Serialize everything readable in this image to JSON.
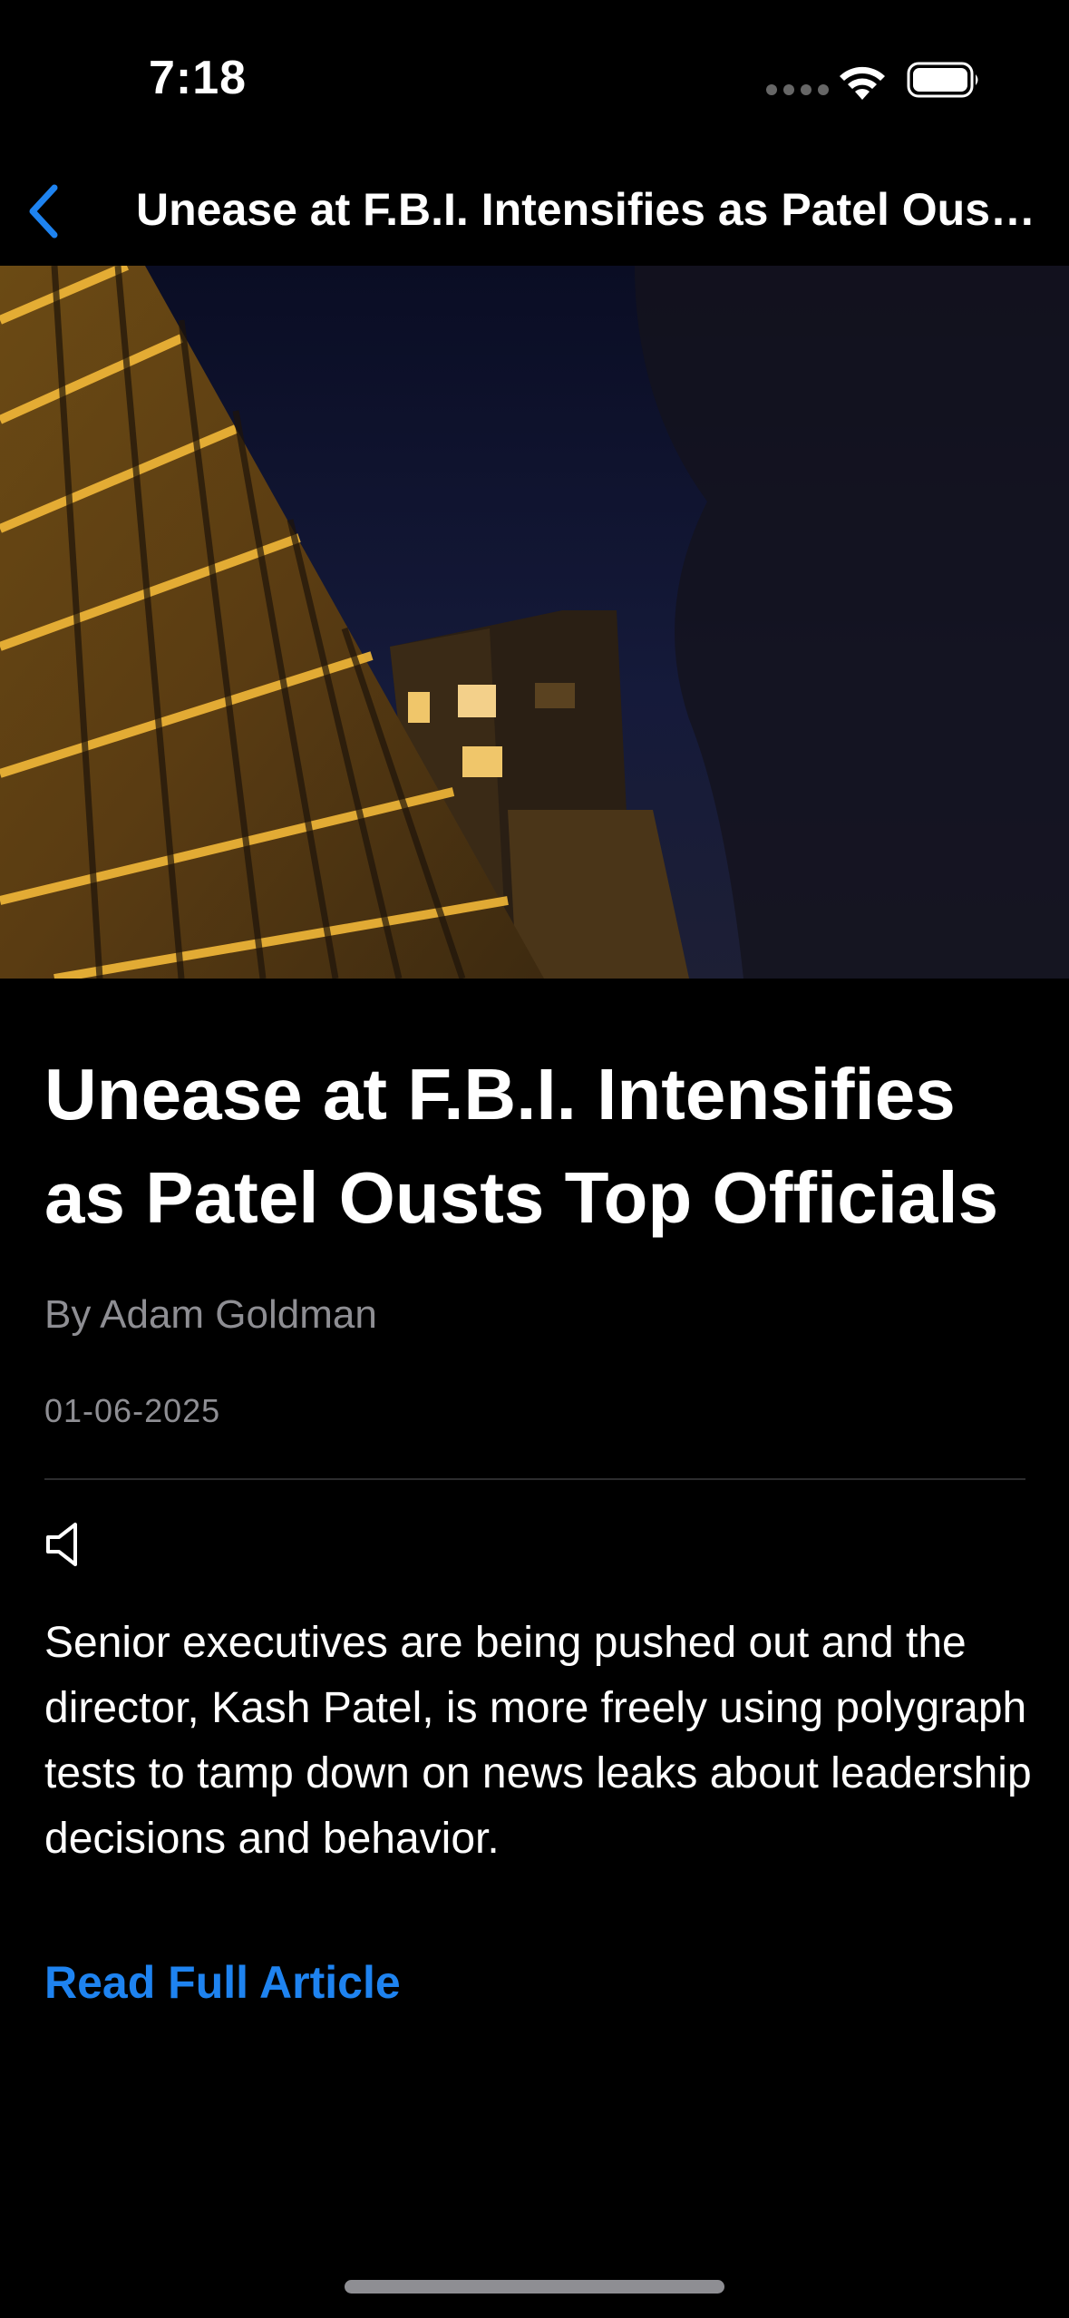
{
  "status_bar": {
    "time": "7:18"
  },
  "nav": {
    "title": "Unease at F.B.I. Intensifies as Patel Ousts Top Officials",
    "back_icon": "chevron-left-icon"
  },
  "article": {
    "title": "Unease at F.B.I. Intensifies as Patel Ousts Top Officials",
    "byline": "By Adam Goldman",
    "date": "01-06-2025",
    "speaker_icon": "speaker-icon",
    "summary": "Senior executives are being pushed out and the director, Kash Patel, is more freely using polygraph tests to tamp down on news leaks about leadership decisions and behavior.",
    "read_more_label": "Read Full Article"
  },
  "colors": {
    "background": "#000000",
    "accent": "#1E83F0",
    "secondary_text": "#8E8E93"
  }
}
